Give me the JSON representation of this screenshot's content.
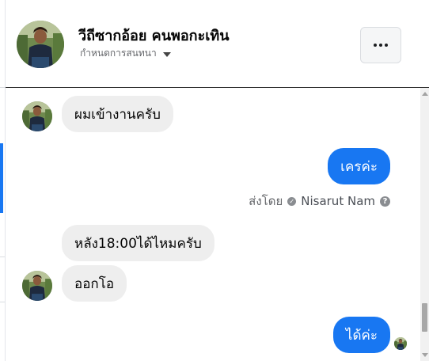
{
  "header": {
    "name": "วีถีซากอ้อย คนพอกะเทิน",
    "subtitle": "กำหนดการสนทนา",
    "more_icon": "more-horizontal-icon"
  },
  "messages": [
    {
      "direction": "incoming",
      "text": "ผมเข้างานครับ"
    },
    {
      "direction": "outgoing",
      "text": "เครค่ะ"
    },
    {
      "direction": "incoming",
      "text": "หลัง18:00ได้ไหมครับ"
    },
    {
      "direction": "incoming",
      "text": "ออกโอ"
    },
    {
      "direction": "outgoing",
      "text": "ได้ค่ะ"
    }
  ],
  "sent_by": {
    "label": "ส่งโดย",
    "sender": "Nisarut Nam",
    "help_glyph": "?"
  },
  "colors": {
    "accent": "#1877f2",
    "incoming_bubble": "#eeeeee",
    "header_border": "#2f2f2f"
  }
}
